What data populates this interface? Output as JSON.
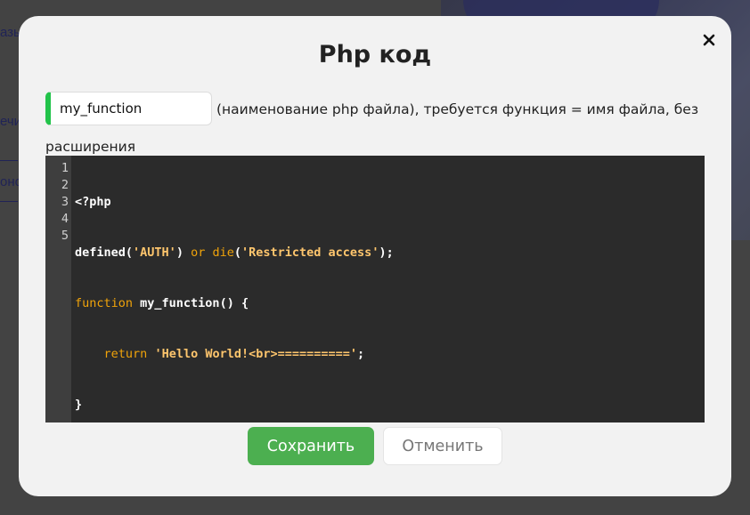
{
  "background": {
    "edge_texts": [
      "азы",
      "ечи",
      "оно"
    ]
  },
  "modal": {
    "title": "Php код",
    "name_input": {
      "value": "my_function"
    },
    "hint": {
      "line1": "(наименование php файла), требуется функция = имя файла, без",
      "line2": "расширения"
    },
    "editor": {
      "line_numbers": [
        "1",
        "2",
        "3",
        "4",
        "5"
      ],
      "lines": [
        [
          {
            "t": "<?php",
            "c": "plain"
          }
        ],
        [
          {
            "t": "defined(",
            "c": "plain"
          },
          {
            "t": "'AUTH'",
            "c": "str"
          },
          {
            "t": ") ",
            "c": "plain"
          },
          {
            "t": "or",
            "c": "kw"
          },
          {
            "t": " ",
            "c": "plain"
          },
          {
            "t": "die",
            "c": "kw"
          },
          {
            "t": "(",
            "c": "plain"
          },
          {
            "t": "'Restricted access'",
            "c": "str"
          },
          {
            "t": ");",
            "c": "plain"
          }
        ],
        [
          {
            "t": "function",
            "c": "kw"
          },
          {
            "t": " my_function() {",
            "c": "plain"
          }
        ],
        [
          {
            "t": "    ",
            "c": "plain"
          },
          {
            "t": "return",
            "c": "kw"
          },
          {
            "t": " ",
            "c": "plain"
          },
          {
            "t": "'Hello World!<br>=========='",
            "c": "str"
          },
          {
            "t": ";",
            "c": "plain"
          }
        ],
        [
          {
            "t": "}",
            "c": "plain"
          }
        ]
      ]
    },
    "buttons": {
      "save": "Сохранить",
      "cancel": "Отменить"
    },
    "colors": {
      "accent_green": "#4caf50",
      "input_marker": "#22c34a"
    },
    "icons": {
      "close": "close-icon"
    }
  }
}
